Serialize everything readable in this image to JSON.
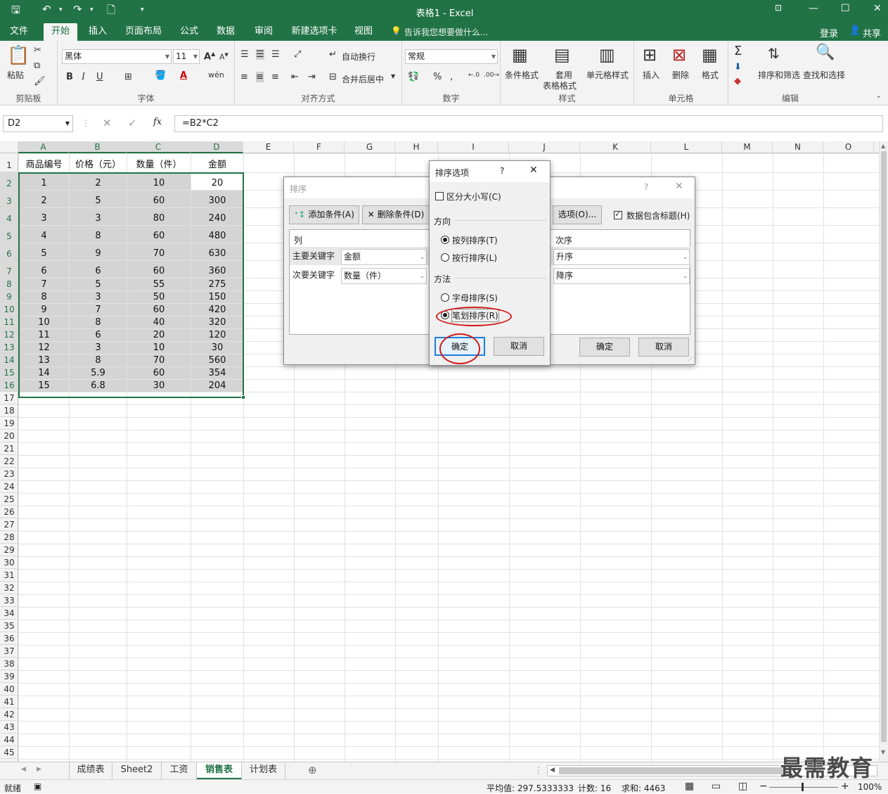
{
  "window": {
    "title": "表格1 - Excel"
  },
  "ribbon_tabs": [
    "文件",
    "开始",
    "插入",
    "页面布局",
    "公式",
    "数据",
    "审阅",
    "新建选项卡",
    "视图"
  ],
  "tell_me": "告诉我您想要做什么...",
  "account": {
    "login": "登录",
    "share": "共享"
  },
  "ribbon": {
    "paste_label": "粘贴",
    "font_name": "黑体",
    "font_size": "11",
    "wrap_text": "自动换行",
    "merge_center": "合并后居中",
    "number_format": "常规",
    "conditional_format": "条件格式",
    "table_format_1": "套用",
    "table_format_2": "表格格式",
    "cell_styles": "单元格样式",
    "insert": "插入",
    "delete": "删除",
    "format": "格式",
    "sort_filter": "排序和筛选",
    "find_select": "查找和选择",
    "groups": {
      "clipboard": "剪贴板",
      "font": "字体",
      "alignment": "对齐方式",
      "number": "数字",
      "styles": "样式",
      "cells": "单元格",
      "editing": "编辑"
    }
  },
  "formula_bar": {
    "name_box": "D2",
    "formula": "=B2*C2"
  },
  "columns": [
    "A",
    "B",
    "C",
    "D",
    "E",
    "F",
    "G",
    "H",
    "I",
    "J",
    "K",
    "L",
    "M",
    "N",
    "O"
  ],
  "rows": [
    "1",
    "2",
    "3",
    "4",
    "5",
    "6",
    "7",
    "8",
    "9",
    "10",
    "11",
    "12",
    "13",
    "14",
    "15",
    "16",
    "17",
    "18",
    "19",
    "20",
    "21",
    "22",
    "23",
    "24",
    "25",
    "26",
    "27",
    "28",
    "29",
    "30",
    "31",
    "32",
    "33",
    "34",
    "35",
    "36",
    "37",
    "38",
    "39",
    "40",
    "41",
    "42",
    "43",
    "44",
    "45"
  ],
  "table": {
    "headers": [
      "商品编号",
      "价格（元）",
      "数量（件）",
      "金额"
    ],
    "rows": [
      [
        "1",
        "2",
        "10",
        "20"
      ],
      [
        "2",
        "5",
        "60",
        "300"
      ],
      [
        "3",
        "3",
        "80",
        "240"
      ],
      [
        "4",
        "8",
        "60",
        "480"
      ],
      [
        "5",
        "9",
        "70",
        "630"
      ],
      [
        "6",
        "6",
        "60",
        "360"
      ],
      [
        "7",
        "5",
        "55",
        "275"
      ],
      [
        "8",
        "3",
        "50",
        "150"
      ],
      [
        "9",
        "7",
        "60",
        "420"
      ],
      [
        "10",
        "8",
        "40",
        "320"
      ],
      [
        "11",
        "6",
        "20",
        "120"
      ],
      [
        "12",
        "3",
        "10",
        "30"
      ],
      [
        "13",
        "8",
        "70",
        "560"
      ],
      [
        "14",
        "5.9",
        "60",
        "354"
      ],
      [
        "15",
        "6.8",
        "30",
        "204"
      ]
    ]
  },
  "sort_dialog": {
    "title": "排序",
    "add_condition": "添加条件(A)",
    "delete_condition": "删除条件(D)",
    "options_button": "选项(O)...",
    "has_headers_label": "数据包含标题(H)",
    "has_headers_checked": true,
    "col_header": "列",
    "order_header": "次序",
    "primary_key_label": "主要关键字",
    "primary_key_value": "金额",
    "primary_order": "升序",
    "secondary_key_label": "次要关键字",
    "secondary_key_value": "数量（件）",
    "secondary_order": "降序",
    "ok": "确定",
    "cancel": "取消"
  },
  "sort_options_dialog": {
    "title": "排序选项",
    "case_sensitive": "区分大小写(C)",
    "case_checked": false,
    "direction_label": "方向",
    "by_column": "按列排序(T)",
    "by_row": "按行排序(L)",
    "method_label": "方法",
    "alphabetic": "字母排序(S)",
    "stroke": "笔划排序(R)",
    "ok": "确定",
    "cancel": "取消"
  },
  "sheet_tabs": [
    "成绩表",
    "Sheet2",
    "工资",
    "销售表",
    "计划表"
  ],
  "active_sheet": "销售表",
  "status": {
    "mode": "就绪",
    "average": "平均值: 297.5333333",
    "count": "计数: 16",
    "sum": "求和: 4463",
    "zoom": "100%"
  },
  "watermark": "最需教育",
  "colors": {
    "excel_green": "#217346",
    "highlight_red": "#d21b1b"
  }
}
